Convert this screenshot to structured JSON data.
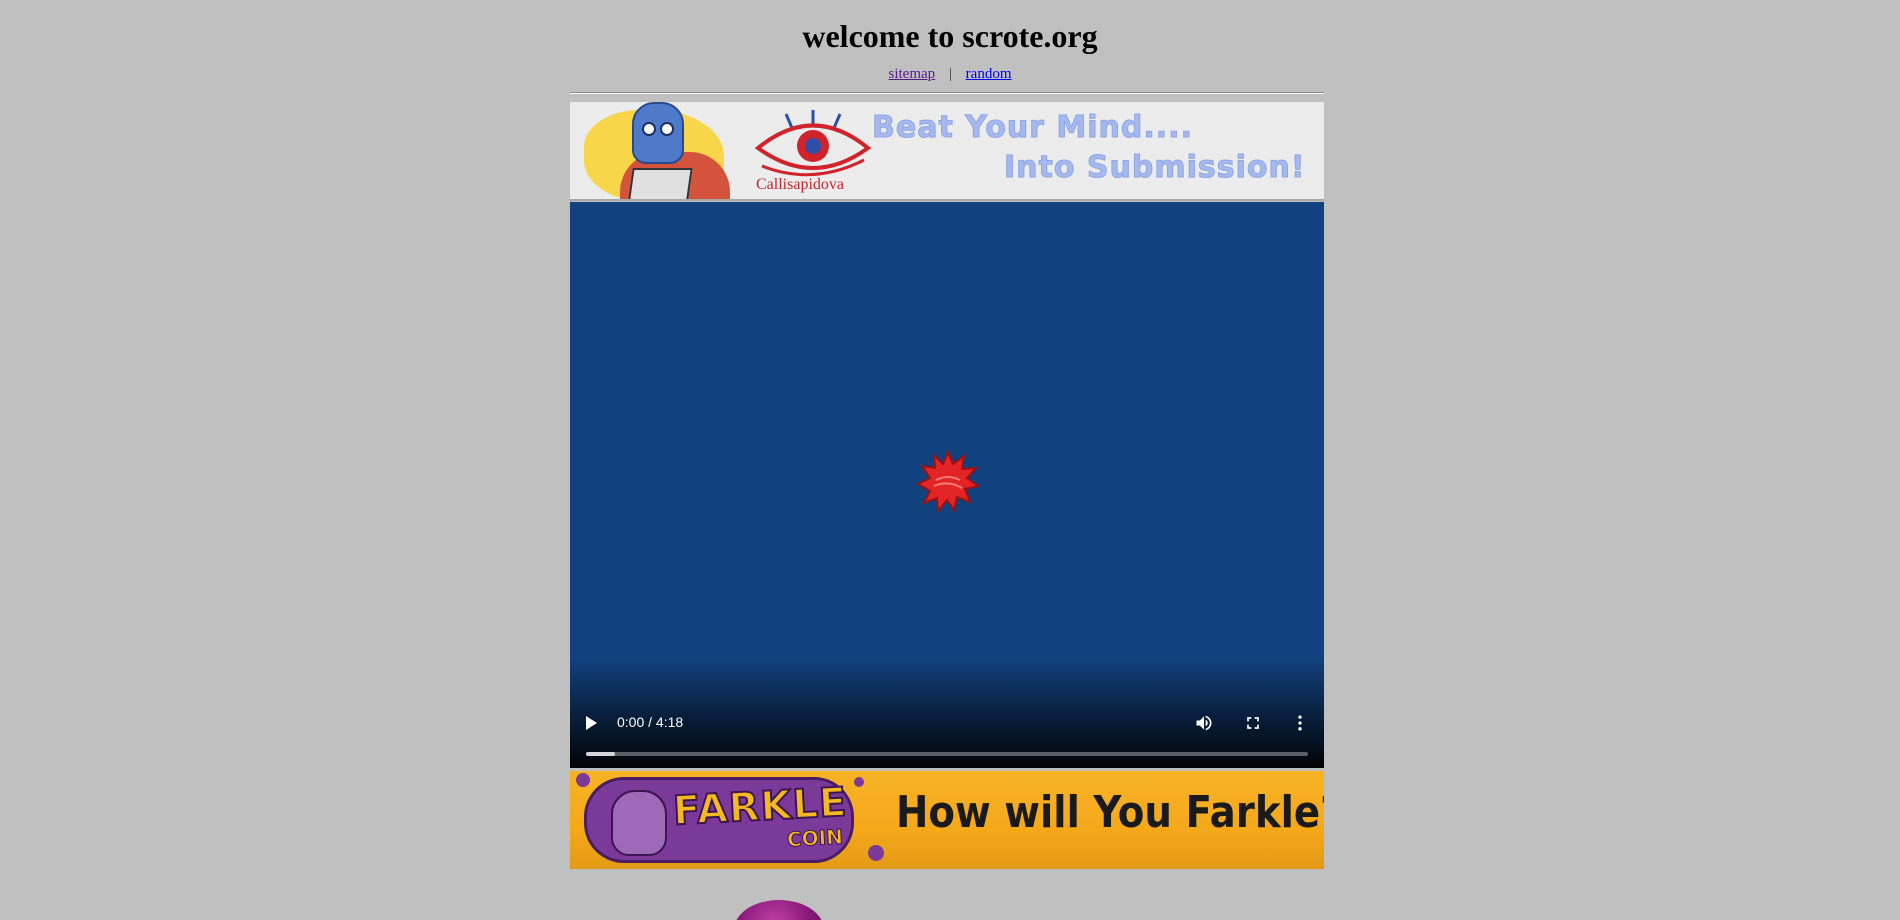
{
  "header": {
    "title": "welcome to scrote.org"
  },
  "nav": {
    "sitemap": "sitemap",
    "separator": "|",
    "random": "random"
  },
  "banner_top": {
    "logo_text": "Callisapidova",
    "slogan_line1": "Beat Your Mind....",
    "slogan_line2": "Into Submission!"
  },
  "video": {
    "time": "0:00 / 4:18",
    "buffered_fraction": 0.04,
    "icons": [
      "play-icon",
      "volume-icon",
      "fullscreen-icon",
      "more-options-icon"
    ]
  },
  "banner_bottom": {
    "brand": "FARKLE",
    "brand_sub": "COIN",
    "slogan": "How will You Farkle?"
  },
  "colors": {
    "background": "#c0c0c0",
    "video_bg": "#11417e",
    "link_visited": "#551a8b",
    "link": "#0000ee"
  }
}
